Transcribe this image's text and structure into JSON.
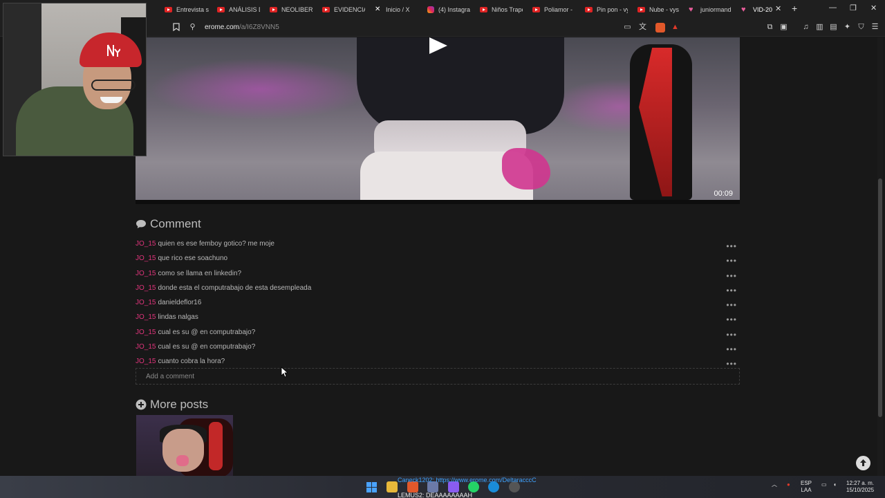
{
  "tabs": [
    {
      "label": "Entrevista s",
      "icon": "youtube-icon"
    },
    {
      "label": "ANÁLISIS D",
      "icon": "youtube-icon"
    },
    {
      "label": "NEOLIBERA",
      "icon": "youtube-icon"
    },
    {
      "label": "EVIDENCIAS",
      "icon": "youtube-icon"
    },
    {
      "label": "Inicio / X",
      "icon": "x-icon"
    },
    {
      "label": "(4) Instagran",
      "icon": "instagram-icon"
    },
    {
      "label": "Niños Trape",
      "icon": "youtube-icon"
    },
    {
      "label": "Poliamor - ",
      "icon": "youtube-icon"
    },
    {
      "label": "Pin pon - vy",
      "icon": "youtube-icon"
    },
    {
      "label": "Nube - vys",
      "icon": "youtube-icon"
    },
    {
      "label": "juniormand",
      "icon": "heart-icon"
    },
    {
      "label": "VID-20",
      "icon": "heart-icon",
      "active": true
    }
  ],
  "address": {
    "domain": "erome.com",
    "path": "/a/I6Z8VNN5"
  },
  "video": {
    "time": "00:09"
  },
  "comments_section": {
    "title": "Comment",
    "items": [
      {
        "user": "JO_15",
        "text": "quien es ese femboy gotico? me moje"
      },
      {
        "user": "JO_15",
        "text": "que rico ese soachuno"
      },
      {
        "user": "JO_15",
        "text": "como se llama en linkedin?"
      },
      {
        "user": "JO_15",
        "text": "donde esta el computrabajo de esta desempleada"
      },
      {
        "user": "JO_15",
        "text": "danieldeflor16"
      },
      {
        "user": "JO_15",
        "text": "lindas nalgas"
      },
      {
        "user": "JO_15",
        "text": "cual es su @ en computrabajo?"
      },
      {
        "user": "JO_15",
        "text": "cual es su @ en computrabajo?"
      },
      {
        "user": "JO_15",
        "text": "cuanto cobra la hora?"
      }
    ],
    "add_placeholder": "Add a comment"
  },
  "more_posts": {
    "title": "More posts"
  },
  "taskbar": {
    "overlay_top": "Caneck1202: https://www.erome.com/DeltaracccC",
    "overlay_bottom": "LEMUS2: DEAAAAAAAAH",
    "lang_top": "ESP",
    "lang_bottom": "LAA",
    "time": "12:27 a. m.",
    "date": "15/10/2025"
  },
  "colors": {
    "username": "#e0347b",
    "background": "#181818"
  }
}
